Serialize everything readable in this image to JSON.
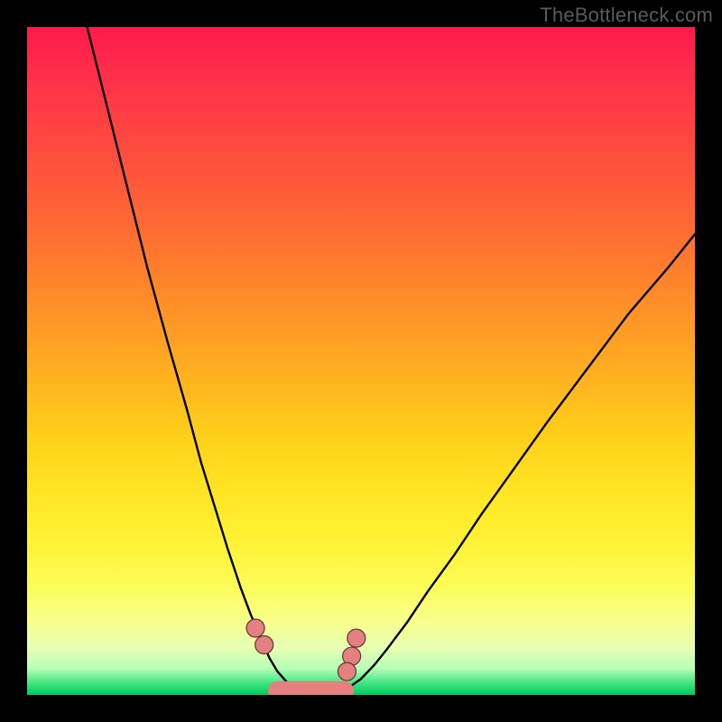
{
  "watermark": "TheBottleneck.com",
  "colors": {
    "frame_bg": "#000000",
    "gradient_top": "#ff1a4d",
    "gradient_mid": "#ffe825",
    "gradient_bottom": "#00c95f",
    "curve_stroke": "#000000",
    "marker_fill": "#e48080",
    "marker_stroke": "#613434"
  },
  "chart_data": {
    "type": "line",
    "title": "",
    "xlabel": "",
    "ylabel": "",
    "xlim": [
      0,
      100
    ],
    "ylim": [
      0,
      100
    ],
    "grid": false,
    "legend": false,
    "series": [
      {
        "name": "left-branch",
        "x": [
          9,
          12,
          15,
          18,
          21,
          24,
          26,
          28,
          30,
          32,
          33.5,
          35,
          36.3,
          37.5,
          39,
          40,
          42,
          45
        ],
        "values": [
          100,
          88,
          76,
          64,
          53,
          42.5,
          35,
          28.5,
          22,
          16,
          12,
          8.5,
          5.5,
          3.5,
          1.8,
          1,
          0.4,
          0.3
        ]
      },
      {
        "name": "right-branch",
        "x": [
          45,
          47,
          48.3,
          50,
          52,
          54,
          57,
          60,
          64,
          68,
          73,
          78,
          84,
          90,
          96,
          100
        ],
        "values": [
          0.3,
          0.6,
          1.2,
          2.4,
          4.5,
          7,
          11,
          15.5,
          21,
          27,
          34,
          41,
          49,
          57,
          64,
          69
        ]
      }
    ],
    "markers": [
      {
        "name": "left-upper-dot",
        "x": 34.2,
        "y": 10.0
      },
      {
        "name": "left-lower-dot",
        "x": 35.5,
        "y": 7.5
      },
      {
        "name": "right-upper-dot",
        "x": 49.3,
        "y": 8.5
      },
      {
        "name": "right-mid-dot",
        "x": 48.6,
        "y": 5.8
      },
      {
        "name": "right-lower-dot",
        "x": 47.9,
        "y": 3.5
      }
    ],
    "base_band": {
      "x_start": 37.5,
      "x_end": 47.5,
      "y": 0.6,
      "height": 1.8
    }
  }
}
